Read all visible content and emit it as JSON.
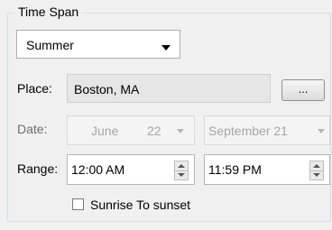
{
  "group": {
    "title": "Time Span"
  },
  "period": {
    "selected": "Summer"
  },
  "place": {
    "label": "Place:",
    "value": "Boston, MA",
    "browse_label": "..."
  },
  "date": {
    "label": "Date:",
    "start_month": "June",
    "start_day": "22",
    "end": "September 21"
  },
  "range": {
    "label": "Range:",
    "start": "12:00 AM",
    "end": "11:59 PM"
  },
  "sun": {
    "label": "Sunrise To sunset",
    "checked": false
  }
}
